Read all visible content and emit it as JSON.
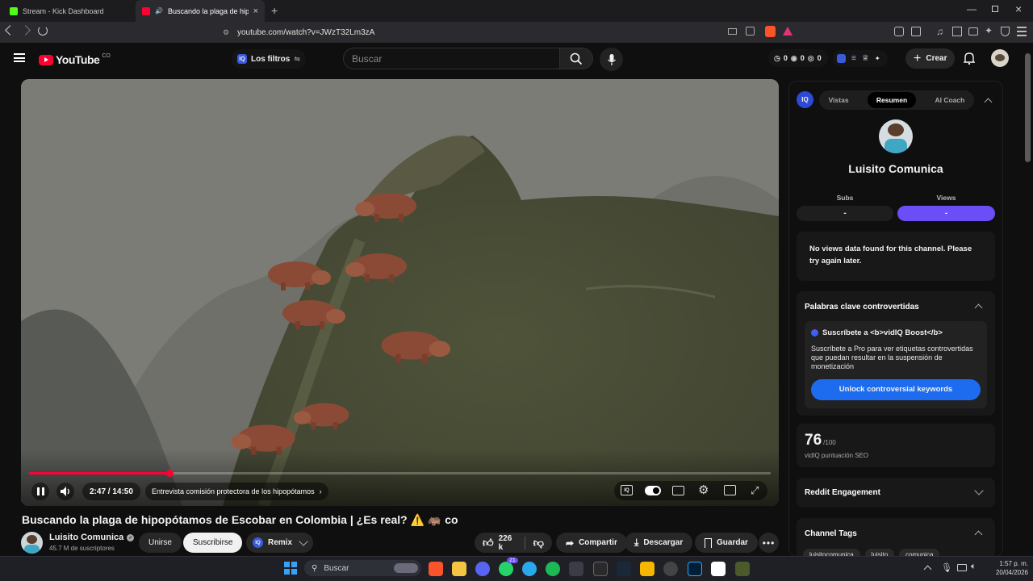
{
  "browser": {
    "tabs": [
      {
        "label": "Stream - Kick Dashboard"
      },
      {
        "label": "Buscando la plaga de hipopó"
      }
    ],
    "url": "youtube.com/watch?v=JWzT32Lm3zA"
  },
  "header": {
    "logo": "YouTube",
    "region": "CO",
    "filters_label": "Los filtros",
    "search_placeholder": "Buscar",
    "stats": [
      "0",
      "0",
      "0"
    ],
    "create_label": "Crear"
  },
  "player": {
    "time": "2:47 / 14:50",
    "chapter": "Entrevista comisión protectora de los hipopótamos",
    "progress": 0.19
  },
  "video": {
    "title": "Buscando la plaga de hipopótamos de Escobar en Colombia | ¿Es real? ⚠️ 🦛 co",
    "channel": "Luisito Comunica",
    "subscribers": "45.7 M de suscriptores",
    "join_label": "Unirse",
    "subscribe_label": "Suscribirse",
    "remix_label": "Remix",
    "likes": "226 k",
    "share_label": "Compartir",
    "download_label": "Descargar",
    "save_label": "Guardar"
  },
  "vidiq": {
    "tabs": [
      "Vistas",
      "Resumen",
      "AI Coach"
    ],
    "channel_name": "Luisito Comunica",
    "subs_label": "Subs",
    "views_label": "Views",
    "subs_value": "-",
    "views_value": "-",
    "no_data": "No views data found for this channel. Please try again later.",
    "keywords_title": "Palabras clave controvertidas",
    "boost_title": "Suscríbete a <b>vidIQ Boost</b>",
    "boost_text": "Suscríbete a Pro para ver etiquetas controvertidas que puedan resultar en la suspensión de monetización",
    "unlock_label": "Unlock controversial keywords",
    "seo_score": "76",
    "seo_max": "/100",
    "seo_label": "vidIQ puntuación SEO",
    "reddit_title": "Reddit Engagement",
    "tags_title": "Channel Tags",
    "tags": [
      "luisitocomunica",
      "luisito",
      "comunica"
    ]
  },
  "taskbar": {
    "search_placeholder": "Buscar",
    "whatsapp_badge": "21",
    "time": "1:57 p. m.",
    "date": "20/04/2026"
  },
  "colors": {
    "accent_red": "#ff0033",
    "vidiq_purple": "#6b4ef6",
    "unlock_blue": "#1d6cf0"
  }
}
